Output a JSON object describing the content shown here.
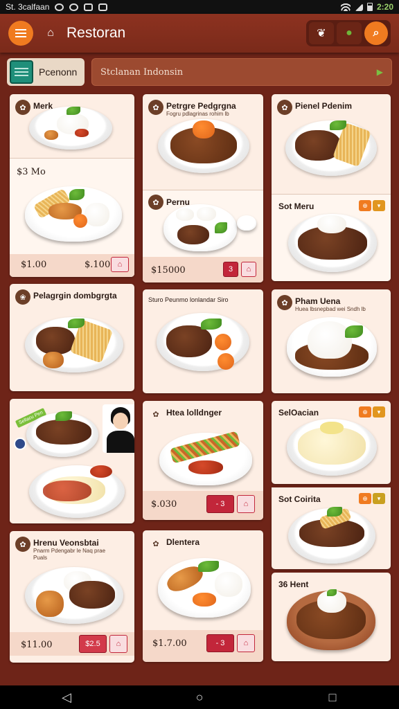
{
  "status_bar": {
    "left_text": "St. 3calfaan",
    "time": "2:20"
  },
  "header": {
    "title": "Restoran"
  },
  "search": {
    "category_label": "Pcenonn",
    "query": "Stclanan Indonsin"
  },
  "cards": {
    "c1": {
      "title": "Merk",
      "sub_title": "$3 Mo",
      "price": "$1.00",
      "price2": "$.100"
    },
    "c2": {
      "title": "Petrgre Pedgrgna",
      "subtitle": "Fogru pdlagrinas rohim lb",
      "sub_title": "Pernu",
      "price": "$15000",
      "btn_label": "3"
    },
    "c3": {
      "title": "Pienel Pdenim",
      "sub_title": "Sot Meru"
    },
    "c4": {
      "title": "Pelagrgin dombgrgta"
    },
    "c5": {
      "title": "Sturo Peunmo lonlandar Siro"
    },
    "c6": {
      "title": "Pham Uena",
      "subtitle": "Huea lbsnepbad wei Sndh lb"
    },
    "c7": {
      "tag": "Sellacu Pen"
    },
    "c8": {
      "title": "Htea lolldnger",
      "price": "$.030",
      "btn_label": "- 3"
    },
    "c9": {
      "title": "SelOacian",
      "sub_title": "Sot Coirita"
    },
    "c10": {
      "title": "Hrenu Veonsbtai",
      "subtitle": "Pnarm Pdengabr le Naq prae",
      "subtitle2": "Puals",
      "price": "$11.00",
      "btn_label": "$2.5"
    },
    "c11": {
      "title": "Dlentera",
      "price": "$1.7.00",
      "btn_label": "- 3"
    },
    "c12": {
      "title": "36 Hent"
    }
  }
}
